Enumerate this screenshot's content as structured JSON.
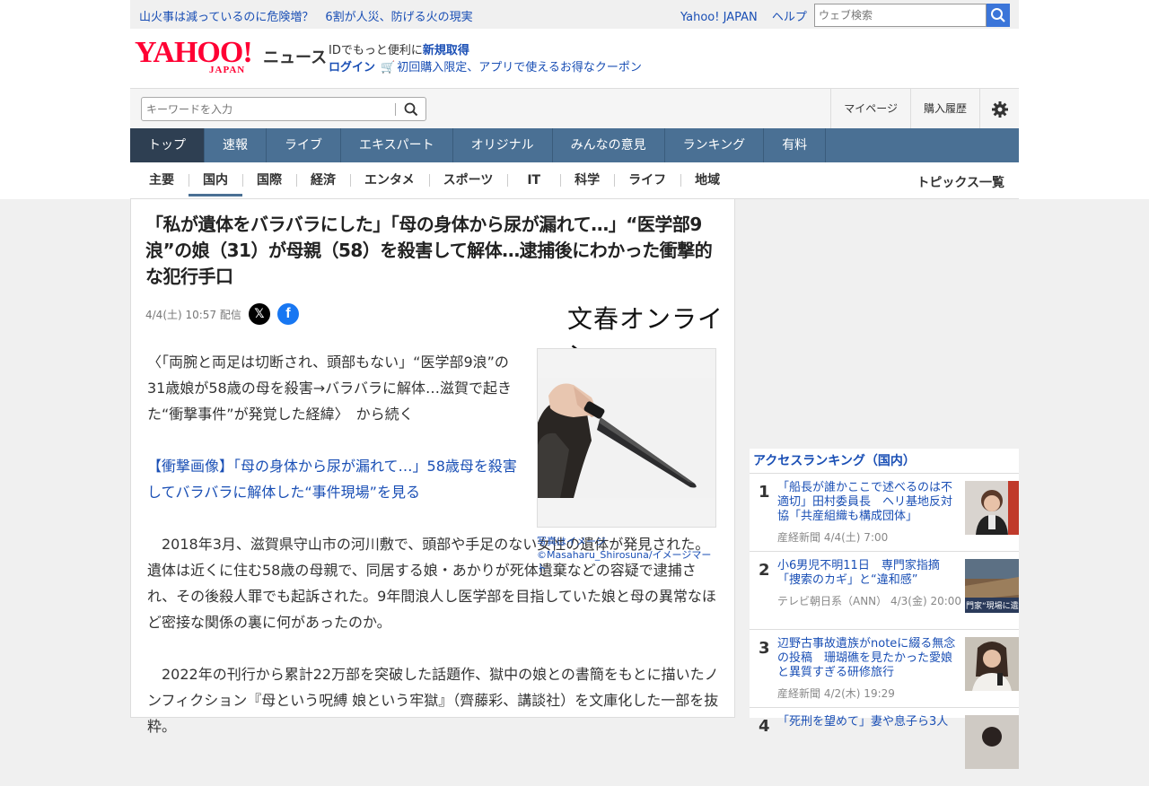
{
  "topbar": {
    "promo": "山火事は減っているのに危険増？　6割が人災、防げる火の現実",
    "yahoo_japan": "Yahoo! JAPAN",
    "help": "ヘルプ",
    "search_placeholder": "ウェブ検索"
  },
  "header": {
    "logo_text": "YAHOO!",
    "logo_sub": "JAPAN",
    "service": "ニュース",
    "id_prefix": "IDでもっと便利に",
    "signup": "新規取得",
    "login": "ログイン",
    "coupon": "初回購入限定、アプリで使えるお得なクーポン"
  },
  "searchrow": {
    "keyword_placeholder": "キーワードを入力",
    "mypage": "マイページ",
    "history": "購入履歴"
  },
  "mainnav": [
    "トップ",
    "速報",
    "ライブ",
    "エキスパート",
    "オリジナル",
    "みんなの意見",
    "ランキング",
    "有料"
  ],
  "subnav": [
    "主要",
    "国内",
    "国際",
    "経済",
    "エンタメ",
    "スポーツ",
    "IT",
    "科学",
    "ライフ",
    "地域"
  ],
  "topics_all": "トピックス一覧",
  "article": {
    "title": "「私が遺体をバラバラにした」「母の身体から尿が漏れて…」“医学部9浪”の娘（31）が母親（58）を殺害して解体…逮捕後にわかった衝撃的な犯行手口",
    "date": "4/4(土) 10:57 配信",
    "source": "文春オンライン",
    "lede": "〈「両腕と両足は切断され、頭部もない」“医学部9浪”の31歳娘が58歳の母を殺害→バラバラに解体…滋賀で起きた“衝撃事件”が発覚した経緯〉　から続く",
    "link": "【衝撃画像】「母の身体から尿が漏れて…」58歳母を殺害してバラバラに解体した“事件現場”を見る",
    "para1": "2018年3月、滋賀県守山市の河川敷で、頭部や手足のない女性の遺体が発見された。遺体は近くに住む58歳の母親で、同居する娘・あかりが死体遺棄などの容疑で逮捕され、その後殺人罪でも起訴された。9年間浪人し医学部を目指していた娘と母の異常なほど密接な関係の裏に何があったのか。",
    "para2": "2022年の刊行から累計22万部を突破した話題作、獄中の娘との書簡をもとに描いたノンフィクション『母という呪縛 娘という牢獄』（齊藤彩、講談社）を文庫化した一部を抜粋。",
    "caption1": "写真はイメージ",
    "caption2": "©Masaharu_Shirosuna/イメージマート"
  },
  "ranking": {
    "heading": "アクセスランキング（国内）",
    "items": [
      {
        "num": "1",
        "title": "「船長が誰かここで述べるのは不適切」田村委員長　ヘリ基地反対協「共産組織も構成団体」",
        "source": "産経新聞 4/4(土) 7:00"
      },
      {
        "num": "2",
        "title": "小6男児不明11日　専門家指摘「捜索のカギ」と“違和感”",
        "source": "テレビ朝日系（ANN）  4/3(金) 20:00",
        "thumb_text": "門家“現場に遺"
      },
      {
        "num": "3",
        "title": "辺野古事故遺族がnoteに綴る無念の投稿　珊瑚礁を見たかった愛娘と異質すぎる研修旅行",
        "source": "産経新聞 4/2(木) 19:29"
      },
      {
        "num": "4",
        "title": "「死刑を望めて」妻や息子ら3人"
      }
    ]
  }
}
